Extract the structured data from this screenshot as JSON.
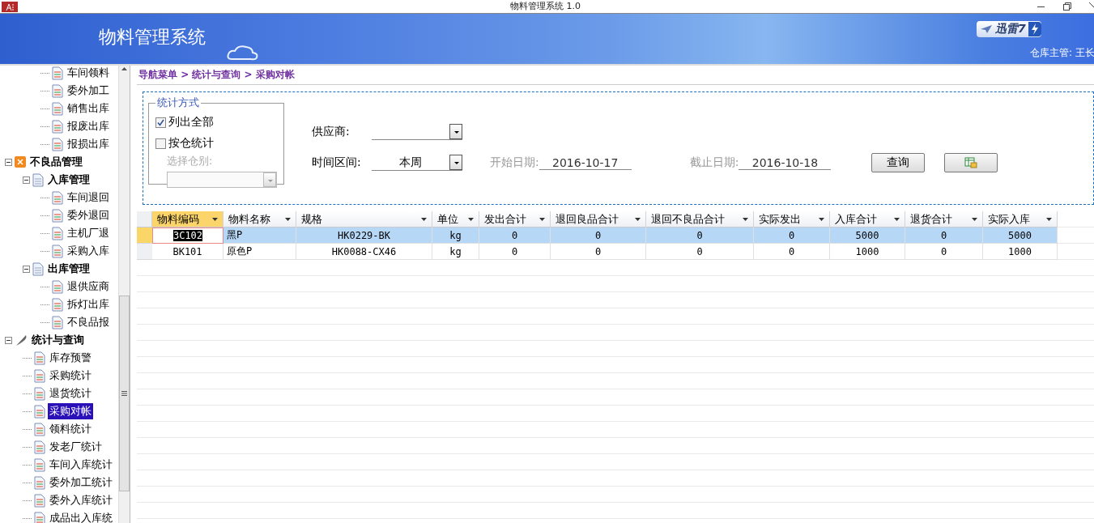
{
  "window": {
    "title": "物料管理系统 1.0"
  },
  "header": {
    "title": "物料管理系统",
    "badge": "迅雷7",
    "user": "仓库主管: 王长"
  },
  "tree": [
    {
      "children": [
        {
          "children": [
            {
              "label": "车间领料",
              "kind": "doc",
              "selected": false
            },
            {
              "label": "委外加工",
              "kind": "doc",
              "selected": false
            },
            {
              "label": "销售出库",
              "kind": "doc",
              "selected": false
            },
            {
              "label": "报废出库",
              "kind": "doc",
              "selected": false
            },
            {
              "label": "报损出库",
              "kind": "doc",
              "selected": false
            }
          ]
        }
      ]
    },
    {
      "label": "不良品管理",
      "kind": "module",
      "expanded": true,
      "children": [
        {
          "label": "入库管理",
          "kind": "page",
          "expanded": true,
          "children": [
            {
              "label": "车间退回",
              "kind": "doc",
              "selected": false
            },
            {
              "label": "委外退回",
              "kind": "doc",
              "selected": false
            },
            {
              "label": "主机厂退",
              "kind": "doc",
              "selected": false
            },
            {
              "label": "采购入库",
              "kind": "doc",
              "selected": false
            }
          ]
        },
        {
          "label": "出库管理",
          "kind": "page",
          "expanded": true,
          "children": [
            {
              "label": "退供应商",
              "kind": "doc",
              "selected": false
            },
            {
              "label": "拆灯出库",
              "kind": "doc",
              "selected": false
            },
            {
              "label": "不良品报",
              "kind": "doc",
              "selected": false
            }
          ]
        }
      ]
    },
    {
      "label": "统计与查询",
      "kind": "feather",
      "expanded": true,
      "children": [
        {
          "label": "库存预警",
          "kind": "doc",
          "selected": false
        },
        {
          "label": "采购统计",
          "kind": "doc",
          "selected": false
        },
        {
          "label": "退货统计",
          "kind": "doc",
          "selected": false
        },
        {
          "label": "采购对帐",
          "kind": "doc",
          "selected": true
        },
        {
          "label": "领料统计",
          "kind": "doc",
          "selected": false
        },
        {
          "label": "发老厂统计",
          "kind": "doc",
          "selected": false
        },
        {
          "label": "车间入库统计",
          "kind": "doc",
          "selected": false
        },
        {
          "label": "委外加工统计",
          "kind": "doc",
          "selected": false
        },
        {
          "label": "委外入库统计",
          "kind": "doc",
          "selected": false
        },
        {
          "label": "成品出入库统",
          "kind": "doc",
          "selected": false
        }
      ]
    }
  ],
  "breadcrumb": "导航菜单 > 统计与查询 > 采购对帐",
  "filter": {
    "group_title": "统计方式",
    "options": [
      {
        "label": "列出全部",
        "checked": true
      },
      {
        "label": "按仓统计",
        "checked": false
      }
    ],
    "warehouse_label": "选择仓别:",
    "warehouse_disabled": true,
    "supplier_label": "供应商:",
    "period_label": "时间区间:",
    "period_value": "本周",
    "start_label": "开始日期:",
    "start_value": "2016-10-17",
    "end_label": "截止日期:",
    "end_value": "2016-10-18",
    "query_button": "查询"
  },
  "table": {
    "columns": [
      {
        "label": "物料编码",
        "selected": true
      },
      {
        "label": "物料名称",
        "selected": false
      },
      {
        "label": "规格",
        "selected": false
      },
      {
        "label": "单位",
        "selected": false
      },
      {
        "label": "发出合计",
        "selected": false
      },
      {
        "label": "退回良品合计",
        "selected": false
      },
      {
        "label": "退回不良品合计",
        "selected": false
      },
      {
        "label": "实际发出",
        "selected": false
      },
      {
        "label": "入库合计",
        "selected": false
      },
      {
        "label": "退货合计",
        "selected": false
      },
      {
        "label": "实际入库",
        "selected": false
      }
    ],
    "rows": [
      {
        "selected": true,
        "cells": [
          "3C102",
          "黑P",
          "HK0229-BK",
          "kg",
          "0",
          "0",
          "0",
          "0",
          "5000",
          "0",
          "5000"
        ]
      },
      {
        "selected": false,
        "cells": [
          "BK101",
          "原色P",
          "HK0088-CX46",
          "kg",
          "0",
          "0",
          "0",
          "0",
          "1000",
          "0",
          "1000"
        ]
      }
    ]
  }
}
